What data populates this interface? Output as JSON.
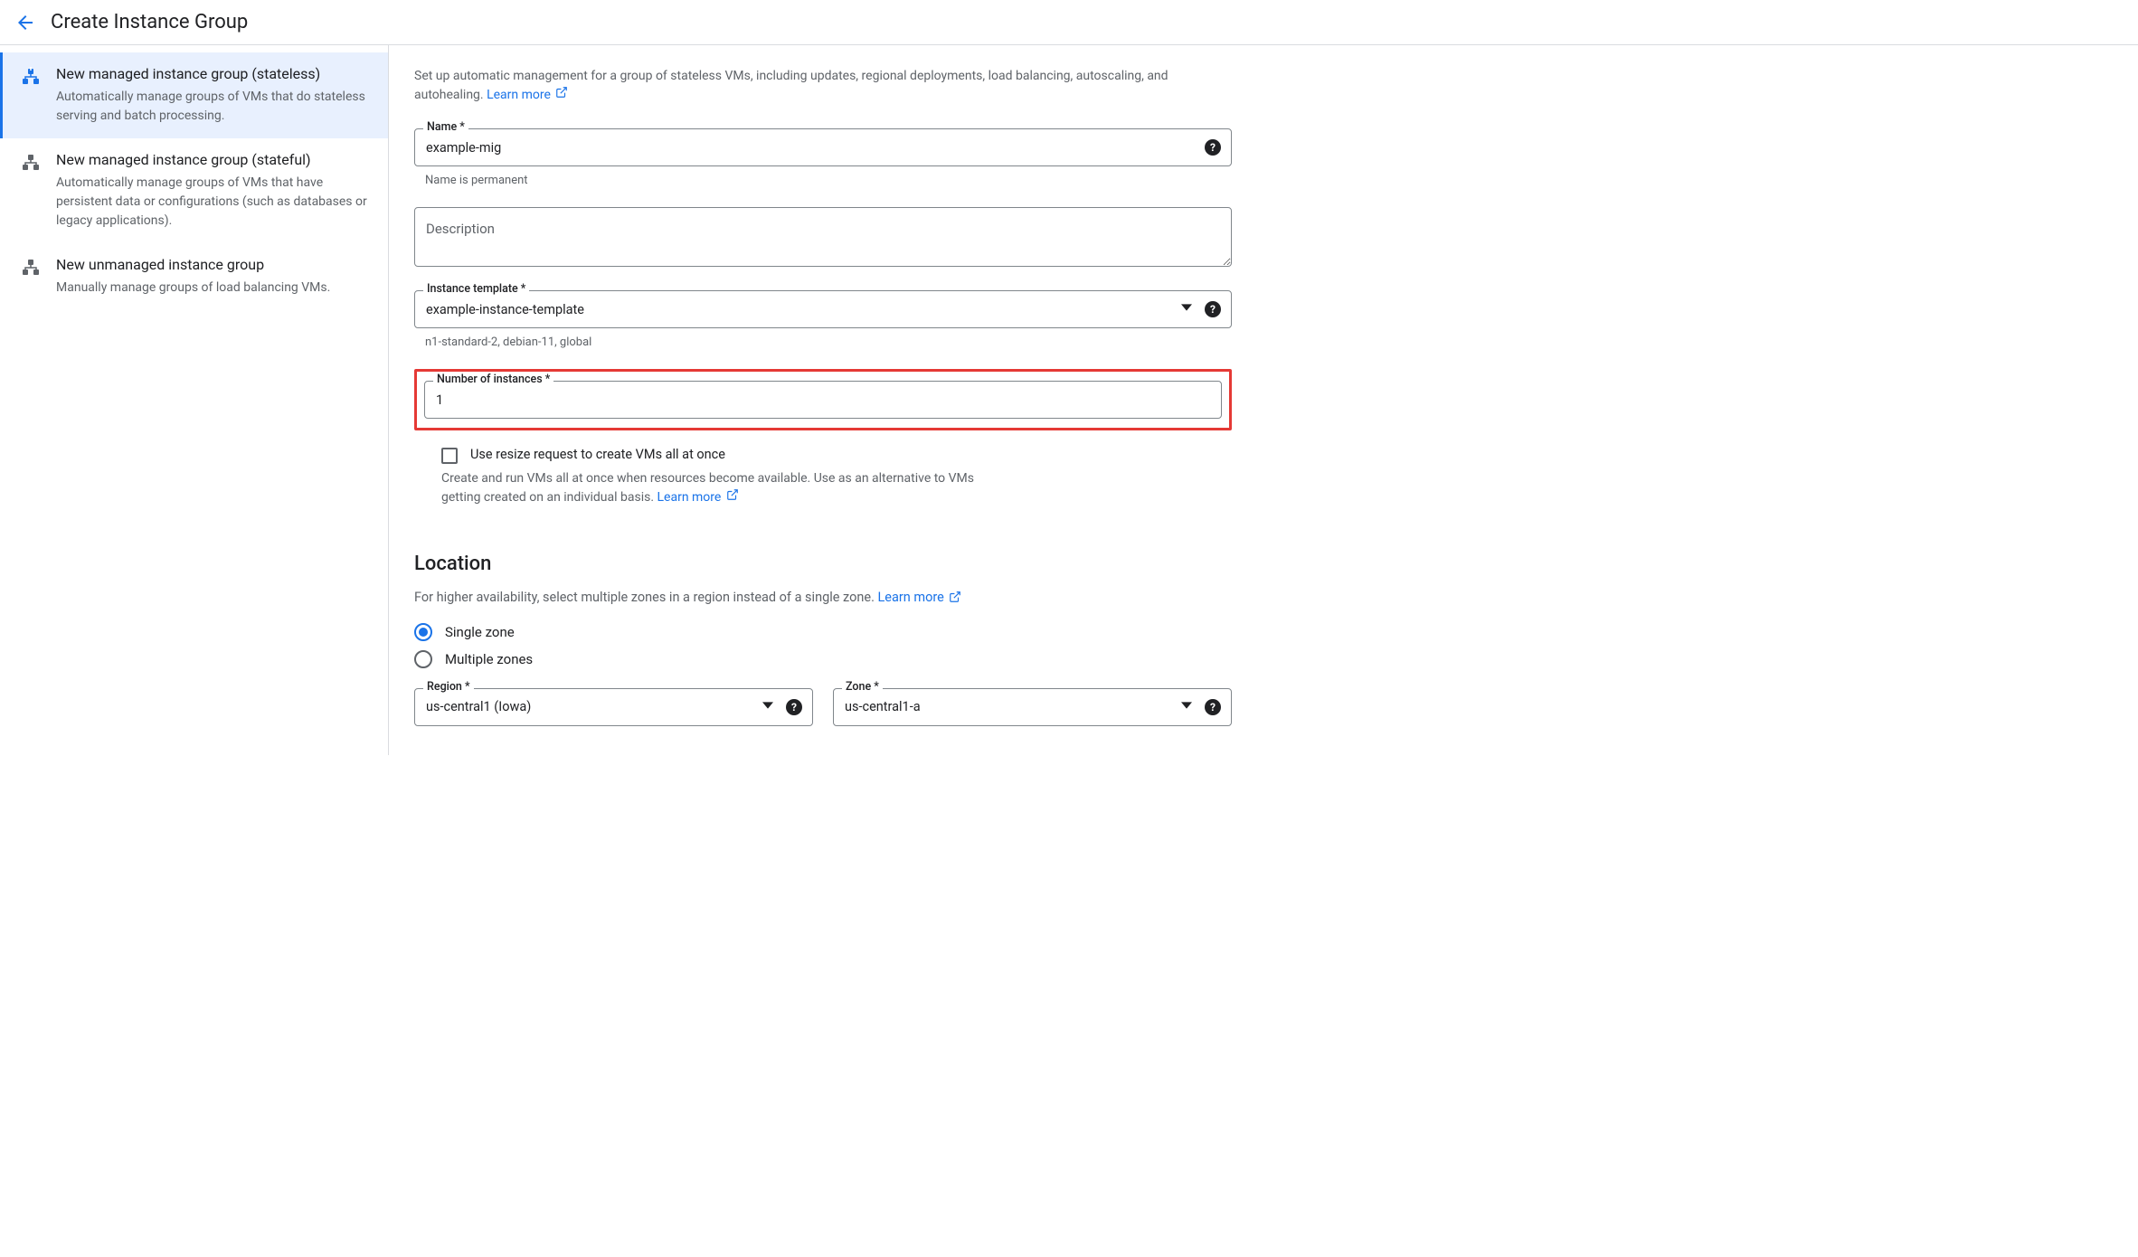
{
  "header": {
    "title": "Create Instance Group"
  },
  "sidebar": {
    "items": [
      {
        "title": "New managed instance group (stateless)",
        "desc": "Automatically manage groups of VMs that do stateless serving and batch processing."
      },
      {
        "title": "New managed instance group (stateful)",
        "desc": "Automatically manage groups of VMs that have persistent data or configurations (such as databases or legacy applications)."
      },
      {
        "title": "New unmanaged instance group",
        "desc": "Manually manage groups of load balancing VMs."
      }
    ]
  },
  "main": {
    "intro": "Set up automatic management for a group of stateless VMs, including updates, regional deployments, load balancing, autoscaling, and autohealing. ",
    "learn_more": "Learn more",
    "name": {
      "label": "Name *",
      "value": "example-mig",
      "helper": "Name is permanent"
    },
    "description": {
      "placeholder": "Description"
    },
    "template": {
      "label": "Instance template *",
      "value": "example-instance-template",
      "helper": "n1-standard-2, debian-11, global"
    },
    "instances": {
      "label": "Number of instances *",
      "value": "1"
    },
    "resize": {
      "label": "Use resize request to create VMs all at once",
      "desc": "Create and run VMs all at once when resources become available. Use as an alternative to VMs getting created on an individual basis. "
    },
    "location": {
      "heading": "Location",
      "intro": "For higher availability, select multiple zones in a region instead of a single zone. ",
      "radio_single": "Single zone",
      "radio_multiple": "Multiple zones",
      "region": {
        "label": "Region *",
        "value": "us-central1 (Iowa)"
      },
      "zone": {
        "label": "Zone *",
        "value": "us-central1-a"
      }
    }
  }
}
